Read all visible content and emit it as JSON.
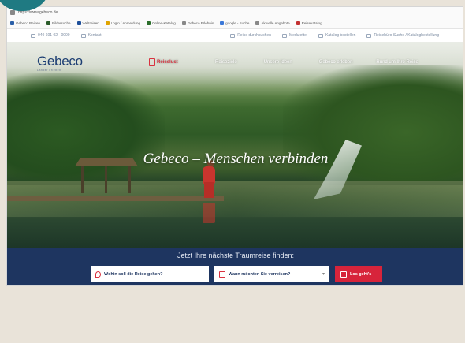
{
  "browser": {
    "url": "https://www.gebeco.de",
    "bookmarks": [
      {
        "label": "Gebeco Reisen",
        "color": "#2a5fa8"
      },
      {
        "label": "Bildersuche",
        "color": "#2b5c2b"
      },
      {
        "label": "Weltreisen",
        "color": "#1d4f9a"
      },
      {
        "label": "Login / Anmeldung",
        "color": "#e0a400"
      },
      {
        "label": "Online-Katalog",
        "color": "#2b6e2b"
      },
      {
        "label": "Gebeco Erlebnis",
        "color": "#888888"
      },
      {
        "label": "google - Suche",
        "color": "#3a78d8"
      },
      {
        "label": "Aktuelle Angebote",
        "color": "#888888"
      },
      {
        "label": "Reisekatalog",
        "color": "#c23030"
      }
    ]
  },
  "utility": {
    "phone": "040 601 02 - 0000",
    "contact": "Kontakt",
    "search": "Reise durchsuchen",
    "wishlist": "Merkzettel",
    "catalog": "Katalog bestellen",
    "agency": "Reisebüro-Suche / Katalogbestellung"
  },
  "nav": {
    "logo": "Gebeco",
    "logo_sub": "Länder erleben",
    "brand_tag": "Reiselust",
    "items": [
      "Reiseziele",
      "Unsere Ideen",
      "Gebeco erleben",
      "Rund um Ihre Reise"
    ]
  },
  "hero": {
    "title": "Gebeco – Menschen verbinden"
  },
  "search": {
    "heading": "Jetzt Ihre nächste Traumreise finden:",
    "where_placeholder": "Wohin soll die Reise gehen?",
    "when_placeholder": "Wann möchten Sie verreisen?",
    "button_label": "Los geht's"
  }
}
